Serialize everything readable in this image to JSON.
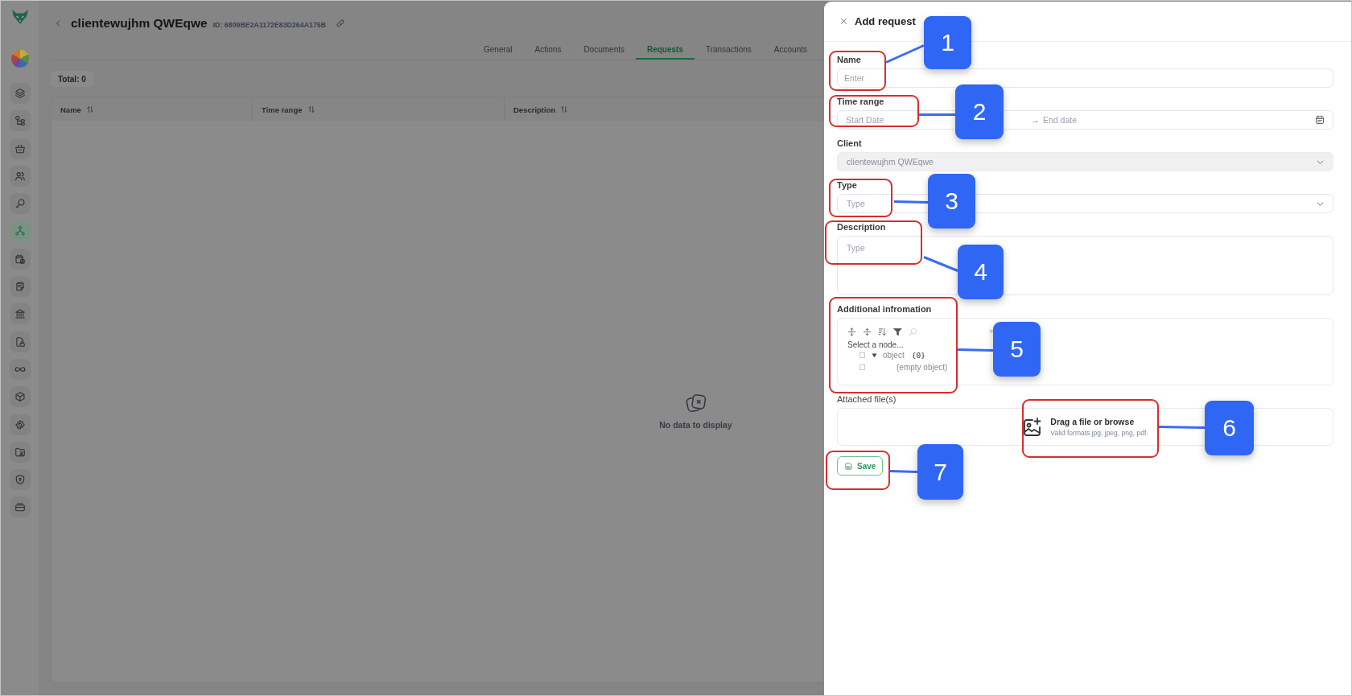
{
  "sidebar": {
    "items": [
      {
        "selected": false
      },
      {
        "selected": false
      },
      {
        "selected": false
      },
      {
        "selected": false
      },
      {
        "selected": false
      },
      {
        "selected": true
      },
      {
        "selected": false
      },
      {
        "selected": false
      },
      {
        "selected": false
      },
      {
        "selected": false
      },
      {
        "selected": false
      },
      {
        "selected": false
      },
      {
        "selected": false
      },
      {
        "selected": false
      },
      {
        "selected": false
      },
      {
        "selected": false
      }
    ]
  },
  "header": {
    "title": "clientewujhm QWEqwe",
    "id": "ID: 6809BE2A1172E83D264A175B"
  },
  "tabs": [
    {
      "label": "General",
      "selected": false
    },
    {
      "label": "Actions",
      "selected": false
    },
    {
      "label": "Documents",
      "selected": false
    },
    {
      "label": "Requests",
      "selected": true
    },
    {
      "label": "Transactions",
      "selected": false
    },
    {
      "label": "Accounts",
      "selected": false
    }
  ],
  "summary": {
    "total": "Total: 0"
  },
  "table": {
    "columns": [
      {
        "label": "Name"
      },
      {
        "label": "Time range"
      },
      {
        "label": "Description"
      }
    ],
    "empty_text": "No data to display"
  },
  "drawer": {
    "title": "Add request",
    "fields": [
      {
        "kind": "input",
        "label": "Name",
        "placeholder": "Enter"
      },
      {
        "kind": "date_range",
        "label": "Time range",
        "placeholder": "Start Date",
        "separator": "→",
        "end_placeholder": "End date"
      },
      {
        "kind": "select",
        "label": "Client",
        "value": "clientewujhm QWEqwe",
        "disabled": true
      },
      {
        "kind": "select",
        "label": "Type",
        "placeholder": "Type",
        "disabled": false
      },
      {
        "kind": "textarea",
        "label": "Description",
        "placeholder": "Type"
      },
      {
        "kind": "json_tree",
        "label": "Additional infromation",
        "hint": "Select a node...",
        "nodes": [
          {
            "label": "object",
            "count": "{0}",
            "checked": false,
            "expanded": true,
            "children": [
              {
                "label": "(empty object)",
                "checked": false
              }
            ]
          }
        ]
      },
      {
        "kind": "upload",
        "label": "Attached file(s)",
        "title": "Drag a file or browse",
        "hint": "Valid formats jpg, jpeg, png, pdf."
      }
    ],
    "save_label": "Save"
  },
  "annotations": [
    {
      "number": "1"
    },
    {
      "number": "2"
    },
    {
      "number": "3"
    },
    {
      "number": "4"
    },
    {
      "number": "5"
    },
    {
      "number": "6"
    },
    {
      "number": "7"
    }
  ]
}
